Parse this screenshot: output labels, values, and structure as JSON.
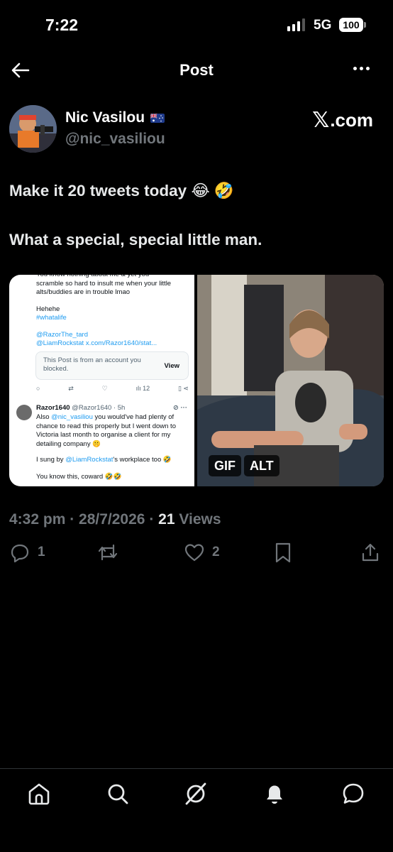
{
  "status_bar": {
    "time": "7:22",
    "network": "5G",
    "battery": "100"
  },
  "header": {
    "title": "Post"
  },
  "author": {
    "name": "Nic Vasilou",
    "handle": "@nic_vasiliou",
    "flag_icon": "australia-flag-icon",
    "source_label": ".com",
    "source_logo": "𝕏"
  },
  "tweet": {
    "line1": "Make it 20 tweets today 😂 🤣",
    "line2": "What a special, special little man."
  },
  "media": {
    "screenshot": {
      "top_text": "You know nothing about me & yet you scramble so hard to insult me when your little alts/buddies are in trouble lmao",
      "hehehe": "Hehehe",
      "hashtag": "#whatalife",
      "mention1": "@RazorThe_tard",
      "mention2": "@LiamRockstat x.com/Razor1640/stat...",
      "quote_text": "This Post is from an account you blocked.",
      "quote_view": "View",
      "views_count": "12",
      "reply_name": "Razor1640",
      "reply_handle": "@Razor1640 · 5h",
      "reply_text_pre": "Also ",
      "reply_mention": "@nic_vasiliou",
      "reply_text_post": " you would've had plenty of chance to read this properly but I went down to Victoria last month to organise a client for my detailing company 🤫",
      "sung_pre": "I sung by ",
      "sung_mention": "@LiamRockstat",
      "sung_post": "'s workplace too 🤣",
      "last_line": "You know this, coward 🤣🤣"
    },
    "gif_badge": "GIF",
    "alt_badge": "ALT"
  },
  "meta": {
    "time": "4:32 pm",
    "date": "28/7/2026",
    "views_count": "21",
    "views_label": "Views"
  },
  "engagement": {
    "replies": "1",
    "retweets": "",
    "likes": "2"
  },
  "colors": {
    "background": "#000000",
    "text_primary": "#e7e9ea",
    "text_secondary": "#71767b",
    "link": "#1d9bf0"
  }
}
